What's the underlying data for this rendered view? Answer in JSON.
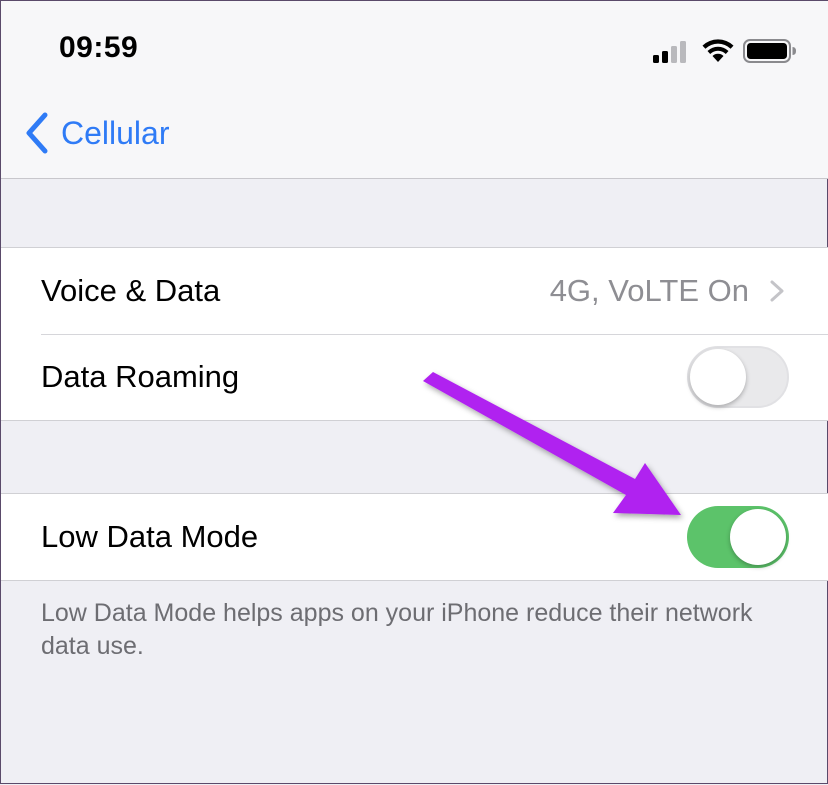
{
  "status_bar": {
    "time": "09:59",
    "icons": [
      "cellular-signal-icon",
      "wifi-icon",
      "battery-icon"
    ]
  },
  "nav": {
    "back_label": "Cellular",
    "accent_color": "#2f7bf6"
  },
  "groups": [
    {
      "rows": [
        {
          "label": "Voice & Data",
          "value": "4G, VoLTE On",
          "type": "disclosure"
        },
        {
          "label": "Data Roaming",
          "type": "toggle",
          "on": false
        }
      ]
    },
    {
      "rows": [
        {
          "label": "Low Data Mode",
          "type": "toggle",
          "on": true
        }
      ],
      "footer": "Low Data Mode helps apps on your iPhone reduce their network data use."
    }
  ],
  "colors": {
    "toggle_on": "#5cc36a",
    "annotation_arrow": "#b020f0",
    "background": "#efeff4"
  }
}
